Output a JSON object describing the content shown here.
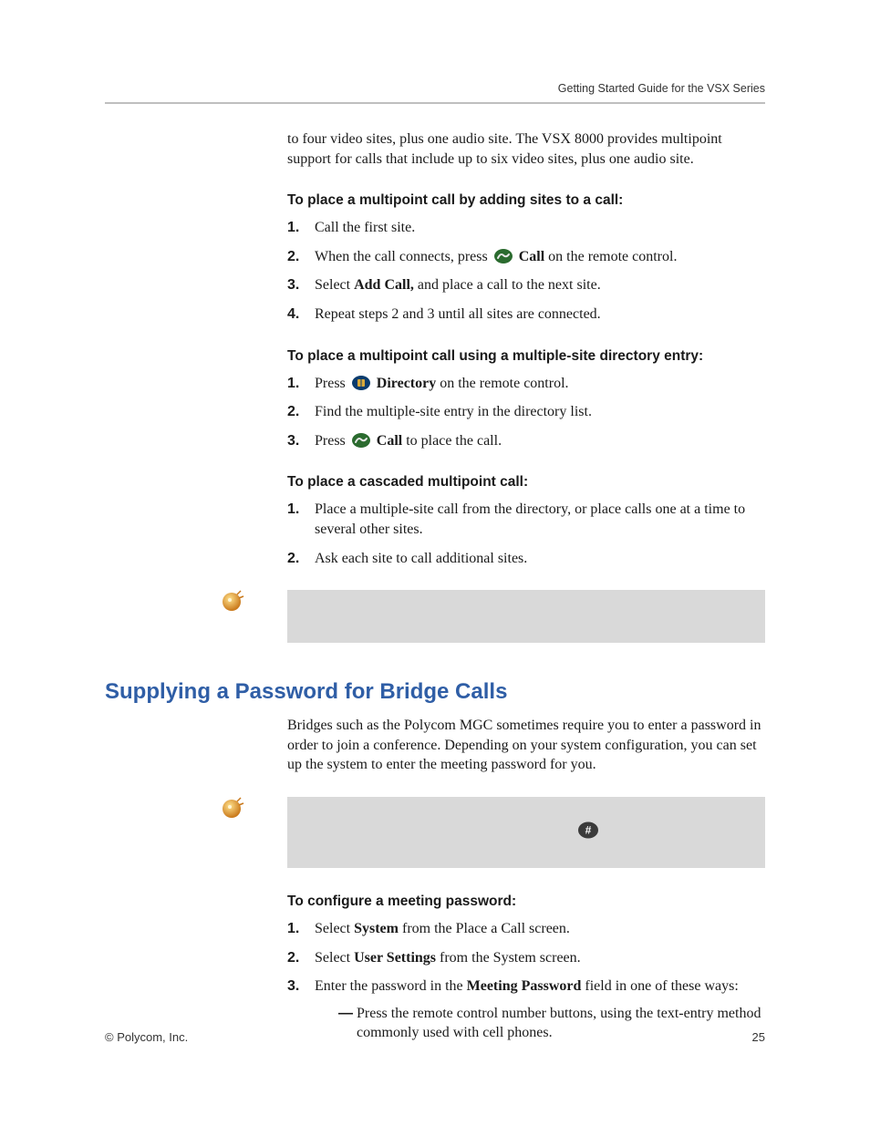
{
  "running_head": "Getting Started Guide for the VSX Series",
  "intro_continued": "to four video sites, plus one audio site. The VSX 8000 provides multipoint support for calls that include up to six video sites, plus one audio site.",
  "proc1": {
    "heading": "To place a multipoint call by adding sites to a call:",
    "steps": [
      {
        "text": "Call the first site."
      },
      {
        "pre": "When the call connects, press ",
        "icon": "call-icon",
        "bold": "Call",
        "post": " on the remote control."
      },
      {
        "pre": "Select ",
        "bold": "Add Call,",
        "post": " and place a call to the next site."
      },
      {
        "text": "Repeat steps 2 and 3 until all sites are connected."
      }
    ]
  },
  "proc2": {
    "heading": "To place a multipoint call using a multiple-site directory entry:",
    "steps": [
      {
        "pre": "Press ",
        "icon": "directory-icon",
        "bold": "Directory",
        "post": " on the remote control."
      },
      {
        "text": "Find the multiple-site entry in the directory list."
      },
      {
        "pre": "Press ",
        "icon": "call-icon",
        "bold": "Call",
        "post": " to place the call."
      }
    ]
  },
  "proc3": {
    "heading": "To place a cascaded multipoint call:",
    "steps": [
      {
        "text": "Place a multiple-site call from the directory, or place calls one at a time to several other sites."
      },
      {
        "text": "Ask each site to call additional sites."
      }
    ]
  },
  "section_heading": "Supplying a Password for Bridge Calls",
  "bridge_intro": "Bridges such as the Polycom MGC sometimes require you to enter a password in order to join a conference. Depending on your system configuration, you can set up the system to enter the meeting password for you.",
  "proc4": {
    "heading": "To configure a meeting password:",
    "steps": [
      {
        "pre": "Select ",
        "bold": "System",
        "post": " from the Place a Call screen."
      },
      {
        "pre": "Select ",
        "bold": "User Settings",
        "post": " from the System screen."
      },
      {
        "pre": "Enter the password in the ",
        "bold": "Meeting Password",
        "post": " field in one of these ways:"
      }
    ],
    "substeps": [
      "Press the remote control number buttons, using the text-entry method commonly used with cell phones."
    ]
  },
  "footer_left": "© Polycom, Inc.",
  "footer_right": "25"
}
